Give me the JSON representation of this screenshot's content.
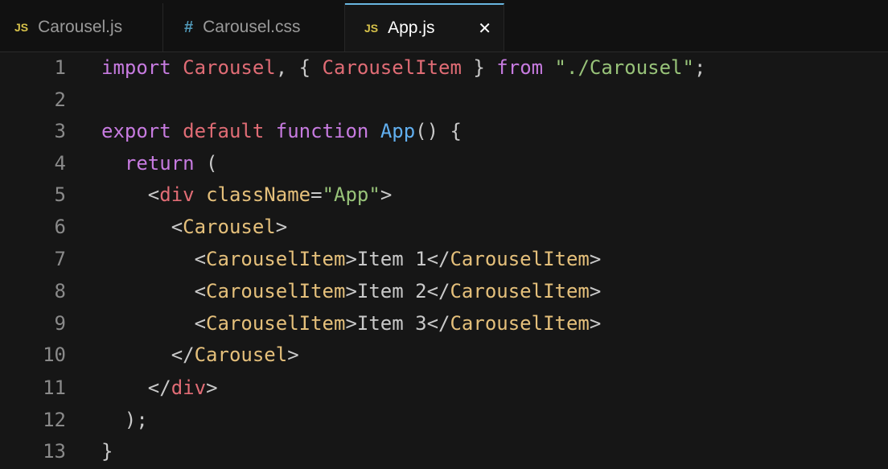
{
  "tabs": [
    {
      "icon": "JS",
      "label": "Carousel.js",
      "active": false
    },
    {
      "icon": "#",
      "label": "Carousel.css",
      "active": false
    },
    {
      "icon": "JS",
      "label": "App.js",
      "active": true,
      "close": "✕"
    }
  ],
  "colors": {
    "keyword": "#c77be0",
    "identifier": "#e06c75",
    "string": "#98c379",
    "function": "#61afef",
    "component": "#e5c07b",
    "active_tab_border": "#69b6e0"
  },
  "code": {
    "line_numbers": [
      "1",
      "2",
      "3",
      "4",
      "5",
      "6",
      "7",
      "8",
      "9",
      "10",
      "11",
      "12",
      "13"
    ],
    "l1": {
      "a": "import",
      "b": " ",
      "c": "Carousel",
      "d": ", { ",
      "e": "CarouselItem",
      "f": " } ",
      "g": "from",
      "h": " ",
      "i": "\"./Carousel\"",
      "j": ";"
    },
    "l3": {
      "a": "export",
      "b": " ",
      "c": "default",
      "d": " ",
      "e": "function",
      "f": " ",
      "g": "App",
      "h": "() {"
    },
    "l4": {
      "a": "  ",
      "b": "return",
      "c": " ("
    },
    "l5": {
      "a": "    <",
      "b": "div",
      "c": " ",
      "d": "className",
      "e": "=",
      "f": "\"App\"",
      "g": ">"
    },
    "l6": {
      "a": "      <",
      "b": "Carousel",
      "c": ">"
    },
    "l7": {
      "a": "        <",
      "b": "CarouselItem",
      "c": ">Item 1</",
      "d": "CarouselItem",
      "e": ">"
    },
    "l8": {
      "a": "        <",
      "b": "CarouselItem",
      "c": ">Item 2</",
      "d": "CarouselItem",
      "e": ">"
    },
    "l9": {
      "a": "        <",
      "b": "CarouselItem",
      "c": ">Item 3</",
      "d": "CarouselItem",
      "e": ">"
    },
    "l10": {
      "a": "      </",
      "b": "Carousel",
      "c": ">"
    },
    "l11": {
      "a": "    </",
      "b": "div",
      "c": ">"
    },
    "l12": {
      "a": "  );"
    },
    "l13": {
      "a": "}"
    }
  }
}
